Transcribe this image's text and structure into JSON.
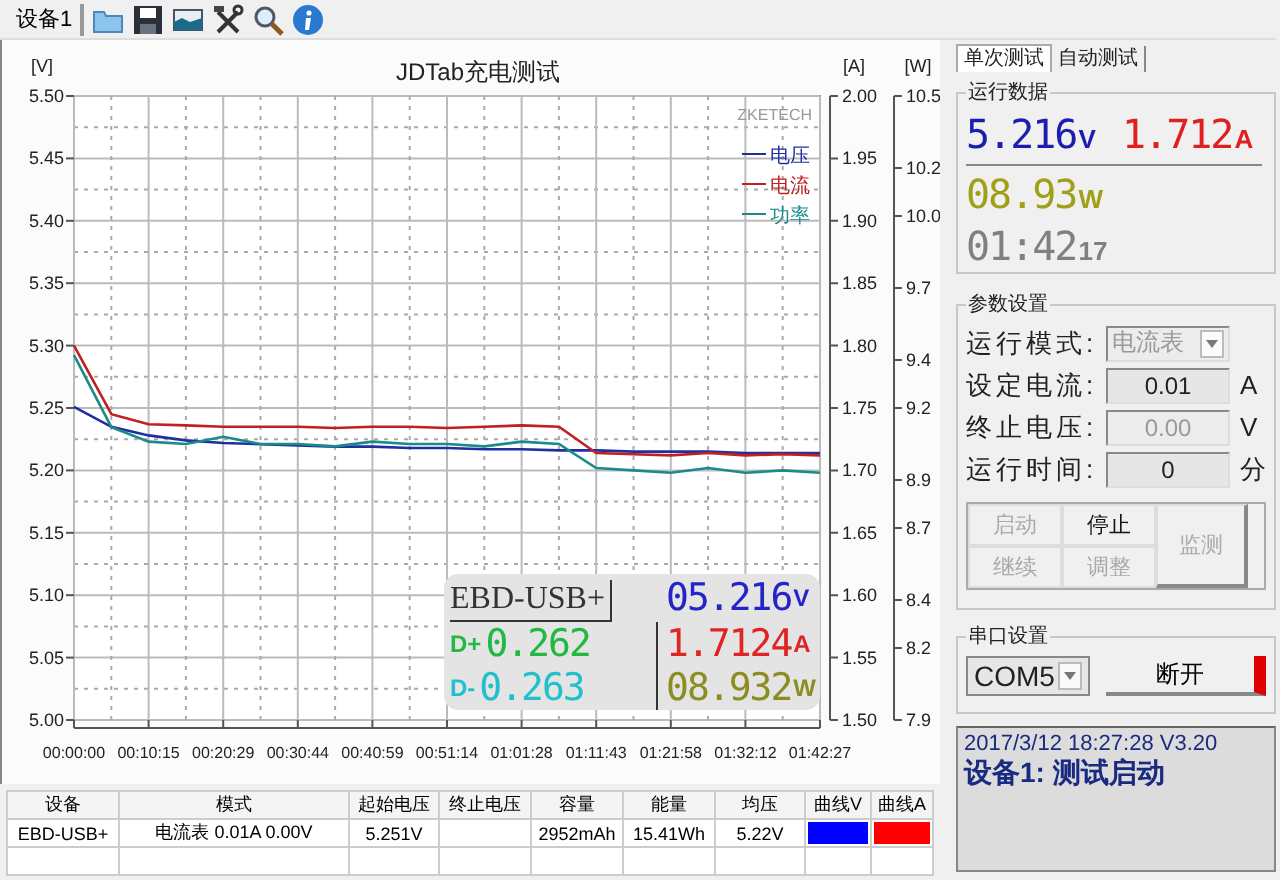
{
  "toolbar": {
    "device_tab": "设备1"
  },
  "chart": {
    "legend_brand": "ZKETECH",
    "chart_data": {
      "type": "line",
      "title": "JDTab充电测试",
      "ylabel": "[V]",
      "y2label": "[A]",
      "y3label": "[W]",
      "categories": [
        "00:00:00",
        null,
        "00:10:15",
        null,
        "00:20:29",
        null,
        "00:30:44",
        null,
        "00:40:59",
        null,
        "00:51:14",
        null,
        "01:01:28",
        null,
        "01:11:43",
        null,
        "01:21:58",
        null,
        "01:32:12",
        null,
        "01:42:27"
      ],
      "ylim": [
        5.0,
        5.5
      ],
      "y2lim": [
        1.5,
        2.0
      ],
      "y3lim": [
        7.9,
        10.5
      ],
      "yticks": [
        {
          "value": 5.0,
          "label": "5.00"
        },
        {
          "value": 5.05,
          "label": "5.05"
        },
        {
          "value": 5.1,
          "label": "5.10"
        },
        {
          "value": 5.15,
          "label": "5.15"
        },
        {
          "value": 5.2,
          "label": "5.20"
        },
        {
          "value": 5.25,
          "label": "5.25"
        },
        {
          "value": 5.3,
          "label": "5.30"
        },
        {
          "value": 5.35,
          "label": "5.35"
        },
        {
          "value": 5.4,
          "label": "5.40"
        },
        {
          "value": 5.45,
          "label": "5.45"
        },
        {
          "value": 5.5,
          "label": "5.50"
        }
      ],
      "y2ticks": [
        {
          "value": 1.5,
          "label": "1.50"
        },
        {
          "value": 1.55,
          "label": "1.55"
        },
        {
          "value": 1.6,
          "label": "1.60"
        },
        {
          "value": 1.65,
          "label": "1.65"
        },
        {
          "value": 1.7,
          "label": "1.70"
        },
        {
          "value": 1.75,
          "label": "1.75"
        },
        {
          "value": 1.8,
          "label": "1.80"
        },
        {
          "value": 1.85,
          "label": "1.85"
        },
        {
          "value": 1.9,
          "label": "1.90"
        },
        {
          "value": 1.95,
          "label": "1.95"
        },
        {
          "value": 2.0,
          "label": "2.00"
        }
      ],
      "y3ticks": [
        {
          "value": 7.9,
          "label": "7.9"
        },
        {
          "value": 8.2,
          "label": "8.2"
        },
        {
          "value": 8.4,
          "label": "8.4"
        },
        {
          "value": 8.7,
          "label": "8.7"
        },
        {
          "value": 8.9,
          "label": "8.9"
        },
        {
          "value": 9.2,
          "label": "9.2"
        },
        {
          "value": 9.4,
          "label": "9.4"
        },
        {
          "value": 9.7,
          "label": "9.7"
        },
        {
          "value": 10.0,
          "label": "10.0"
        },
        {
          "value": 10.2,
          "label": "10.2"
        },
        {
          "value": 10.5,
          "label": "10.5"
        }
      ],
      "grid": true,
      "legend": true,
      "series": [
        {
          "name": "电压",
          "color": "#1f2f9f",
          "values": [
            5.251,
            5.235,
            5.228,
            5.224,
            5.222,
            5.221,
            5.22,
            5.219,
            5.219,
            5.218,
            5.218,
            5.217,
            5.217,
            5.216,
            5.216,
            5.215,
            5.215,
            5.215,
            5.214,
            5.214,
            5.214
          ]
        },
        {
          "name": "电流",
          "color": "#c02020",
          "axis": "y2",
          "values": [
            1.8,
            1.745,
            1.737,
            1.736,
            1.735,
            1.735,
            1.735,
            1.734,
            1.735,
            1.735,
            1.734,
            1.735,
            1.736,
            1.735,
            1.714,
            1.713,
            1.712,
            1.714,
            1.712,
            1.713,
            1.712
          ]
        },
        {
          "name": "功率",
          "color": "#1a8a8a",
          "axis": "y3",
          "values": [
            9.42,
            9.12,
            9.06,
            9.05,
            9.08,
            9.05,
            9.05,
            9.04,
            9.06,
            9.05,
            9.05,
            9.04,
            9.06,
            9.05,
            8.95,
            8.94,
            8.93,
            8.95,
            8.93,
            8.94,
            8.93
          ]
        }
      ]
    },
    "device_display": {
      "model": "EBD-USB+",
      "readings": [
        {
          "label": "D+",
          "value": "0.262",
          "color": "#22b844"
        },
        {
          "label": "D-",
          "value": "0.263",
          "color": "#20c0cc"
        }
      ],
      "meters": [
        {
          "value": "05.216",
          "unit": "V",
          "color": "#2424c8"
        },
        {
          "value": "1.7124",
          "unit": "A",
          "color": "#e02424"
        },
        {
          "value": "08.932",
          "unit": "W",
          "color": "#8c8c20"
        }
      ]
    }
  },
  "tabs": [
    {
      "label": "单次测试",
      "selected": true
    },
    {
      "label": "自动测试",
      "selected": false
    }
  ],
  "run_data": {
    "title": "运行数据",
    "meters": [
      {
        "value": "5.216",
        "unit": "V",
        "color": "#1c1cb0"
      },
      {
        "value": "1.712",
        "unit": "A",
        "color": "#e02020"
      },
      {
        "value": "08.93",
        "unit": "W",
        "color": "#a0a018"
      },
      {
        "value": "01:42",
        "unit": "17",
        "color": "#808080"
      }
    ]
  },
  "params": {
    "title": "参数设置",
    "fields": [
      {
        "label": "运行模式:",
        "kind": "select",
        "value": "电流表",
        "disabled": true
      },
      {
        "label": "设定电流:",
        "kind": "input",
        "value": "0.01",
        "unit": "A",
        "disabled": false
      },
      {
        "label": "终止电压:",
        "kind": "input",
        "value": "0.00",
        "unit": "V",
        "disabled": true
      },
      {
        "label": "运行时间:",
        "kind": "input",
        "value": "0",
        "unit": "分",
        "disabled": false
      }
    ],
    "buttons": [
      {
        "label": "启动",
        "kind": "normal",
        "disabled": true
      },
      {
        "label": "停止",
        "kind": "normal",
        "disabled": false
      },
      {
        "label": "监测",
        "kind": "tall",
        "disabled": true
      },
      {
        "label": "继续",
        "kind": "normal",
        "disabled": true
      },
      {
        "label": "调整",
        "kind": "normal",
        "disabled": true
      }
    ]
  },
  "serial": {
    "title": "串口设置",
    "port": "COM5",
    "button": "断开",
    "connected": true
  },
  "status": {
    "timestamp": "2017/3/12 18:27:28  V3.20",
    "message": "设备1: 测试启动"
  },
  "table": {
    "columns": [
      "设备",
      "模式",
      "起始电压",
      "终止电压",
      "容量",
      "能量",
      "均压",
      "曲线V",
      "曲线A"
    ],
    "rows": [
      {
        "device": "EBD-USB+",
        "mode": "电流表  0.01A  0.00V",
        "start_voltage": "5.251V",
        "capacity": "2952mAh",
        "energy": "15.41Wh",
        "avg_voltage": "5.22V",
        "curve_v": {
          "color": "#0000ff"
        },
        "curve_a": {
          "color": "#ff0000"
        }
      }
    ]
  }
}
